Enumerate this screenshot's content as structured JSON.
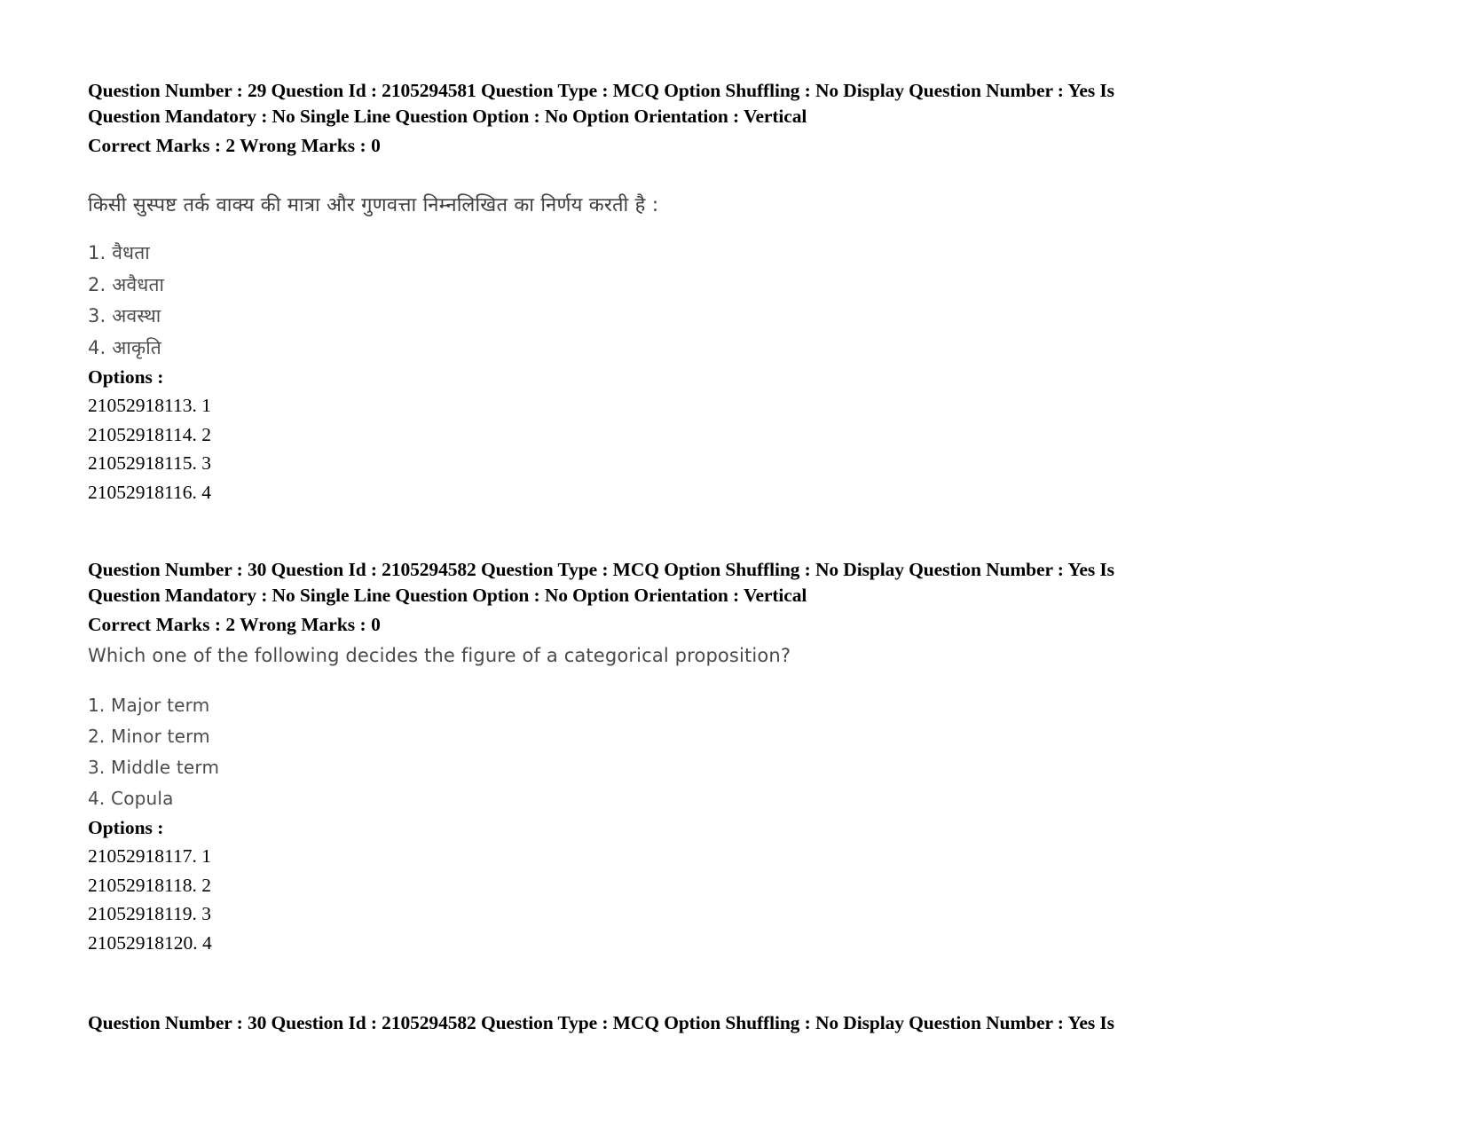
{
  "page": {
    "background": "#ffffff",
    "text_color": "#000000"
  },
  "questions": [
    {
      "meta_line_1": "Question Number : 29 Question Id : 2105294581 Question Type : MCQ Option Shuffling : No Display Question Number : Yes Is",
      "meta_line_2": "Question Mandatory : No Single Line Question Option : No Option Orientation : Vertical",
      "marks_line": "Correct Marks : 2 Wrong Marks : 0",
      "question_text": "किसी सुस्पष्ट तर्क वाक्य की मात्रा और गुणवत्ता निम्नलिखित का निर्णय करती है :",
      "choices": [
        "1. वैधता",
        "2. अवैधता",
        "3. अवस्था",
        "4. आकृति"
      ],
      "options_label": "Options :",
      "option_ids": [
        "21052918113. 1",
        "21052918114. 2",
        "21052918115. 3",
        "21052918116. 4"
      ]
    },
    {
      "meta_line_1": "Question Number : 30 Question Id : 2105294582 Question Type : MCQ Option Shuffling : No Display Question Number : Yes Is",
      "meta_line_2": "Question Mandatory : No Single Line Question Option : No Option Orientation : Vertical",
      "marks_line": "Correct Marks : 2 Wrong Marks : 0",
      "question_text": "Which one of the following decides the figure of a categorical proposition?",
      "choices": [
        "1. Major term",
        "2. Minor term",
        "3. Middle term",
        "4. Copula"
      ],
      "options_label": "Options :",
      "option_ids": [
        "21052918117. 1",
        "21052918118. 2",
        "21052918119. 3",
        "21052918120. 4"
      ]
    }
  ],
  "footer": {
    "meta_line_1": "Question Number : 30 Question Id : 2105294582 Question Type : MCQ Option Shuffling : No Display Question Number : Yes Is"
  }
}
